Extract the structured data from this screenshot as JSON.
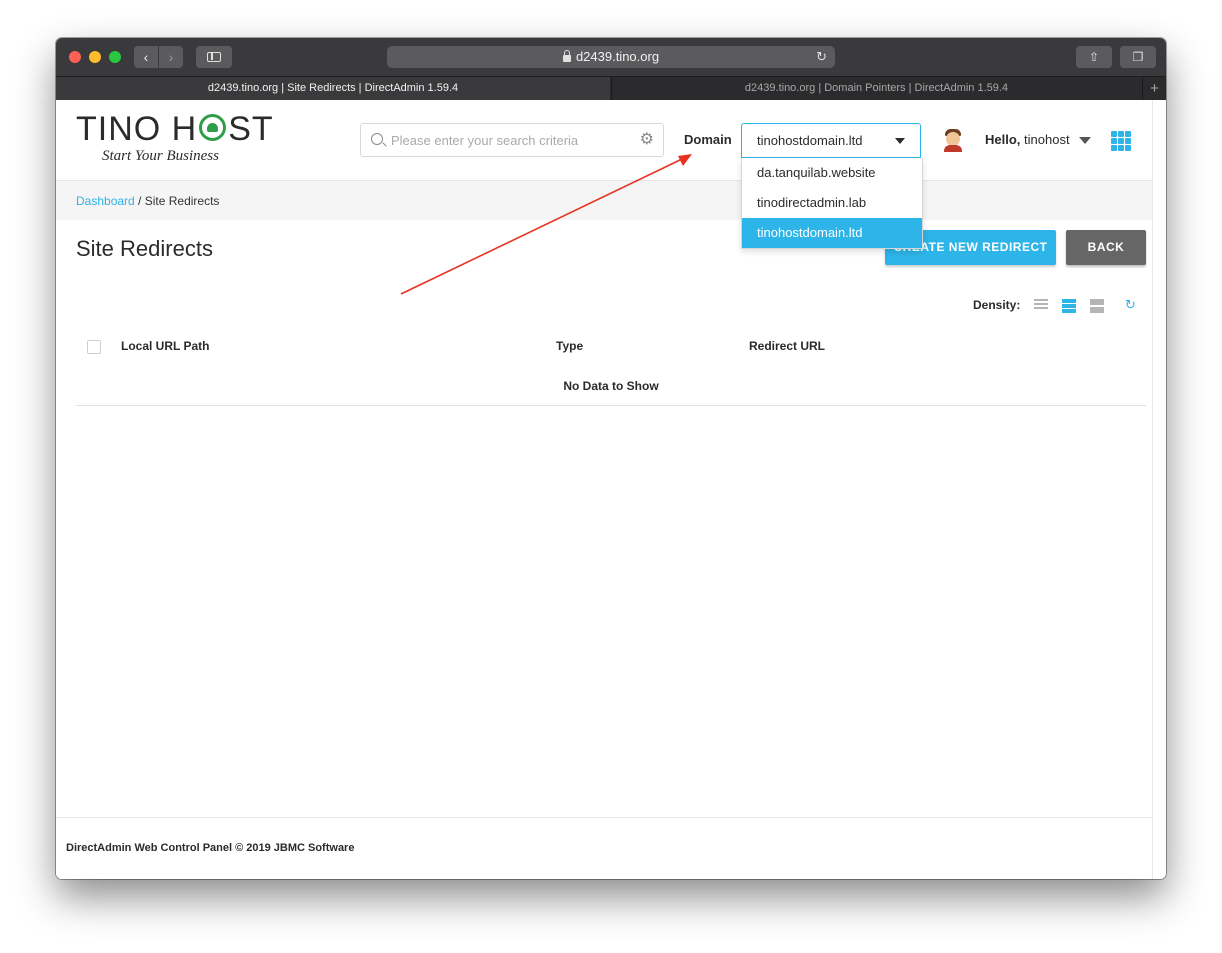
{
  "browser": {
    "url": "d2439.tino.org",
    "tabs": [
      {
        "label": "d2439.tino.org | Site Redirects | DirectAdmin 1.59.4",
        "active": true
      },
      {
        "label": "d2439.tino.org | Domain Pointers | DirectAdmin 1.59.4",
        "active": false
      }
    ],
    "new_tab": "+"
  },
  "header": {
    "logo_text_left": "TINO H",
    "logo_text_right": "ST",
    "logo_tagline": "Start Your Business",
    "search_placeholder": "Please enter your search criteria",
    "domain_label": "Domain",
    "domain_selected": "tinohostdomain.ltd",
    "domain_options": [
      "da.tanquilab.website",
      "tinodirectadmin.lab",
      "tinohostdomain.ltd"
    ],
    "hello_prefix": "Hello,",
    "username": "tinohost"
  },
  "breadcrumb": {
    "root": "Dashboard",
    "separator": " / ",
    "current": "Site Redirects"
  },
  "page": {
    "title": "Site Redirects",
    "create_button": "CREATE NEW REDIRECT",
    "back_button": "BACK",
    "density_label": "Density:"
  },
  "table": {
    "columns": [
      "Local URL Path",
      "Type",
      "Redirect URL"
    ],
    "empty_text": "No Data to Show"
  },
  "footer": {
    "text": "DirectAdmin Web Control Panel © 2019 JBMC Software"
  },
  "colors": {
    "accent": "#2db4e8",
    "annotation_arrow": "#e8321f",
    "back_button": "#666666",
    "logo_green": "#2e9e48"
  }
}
